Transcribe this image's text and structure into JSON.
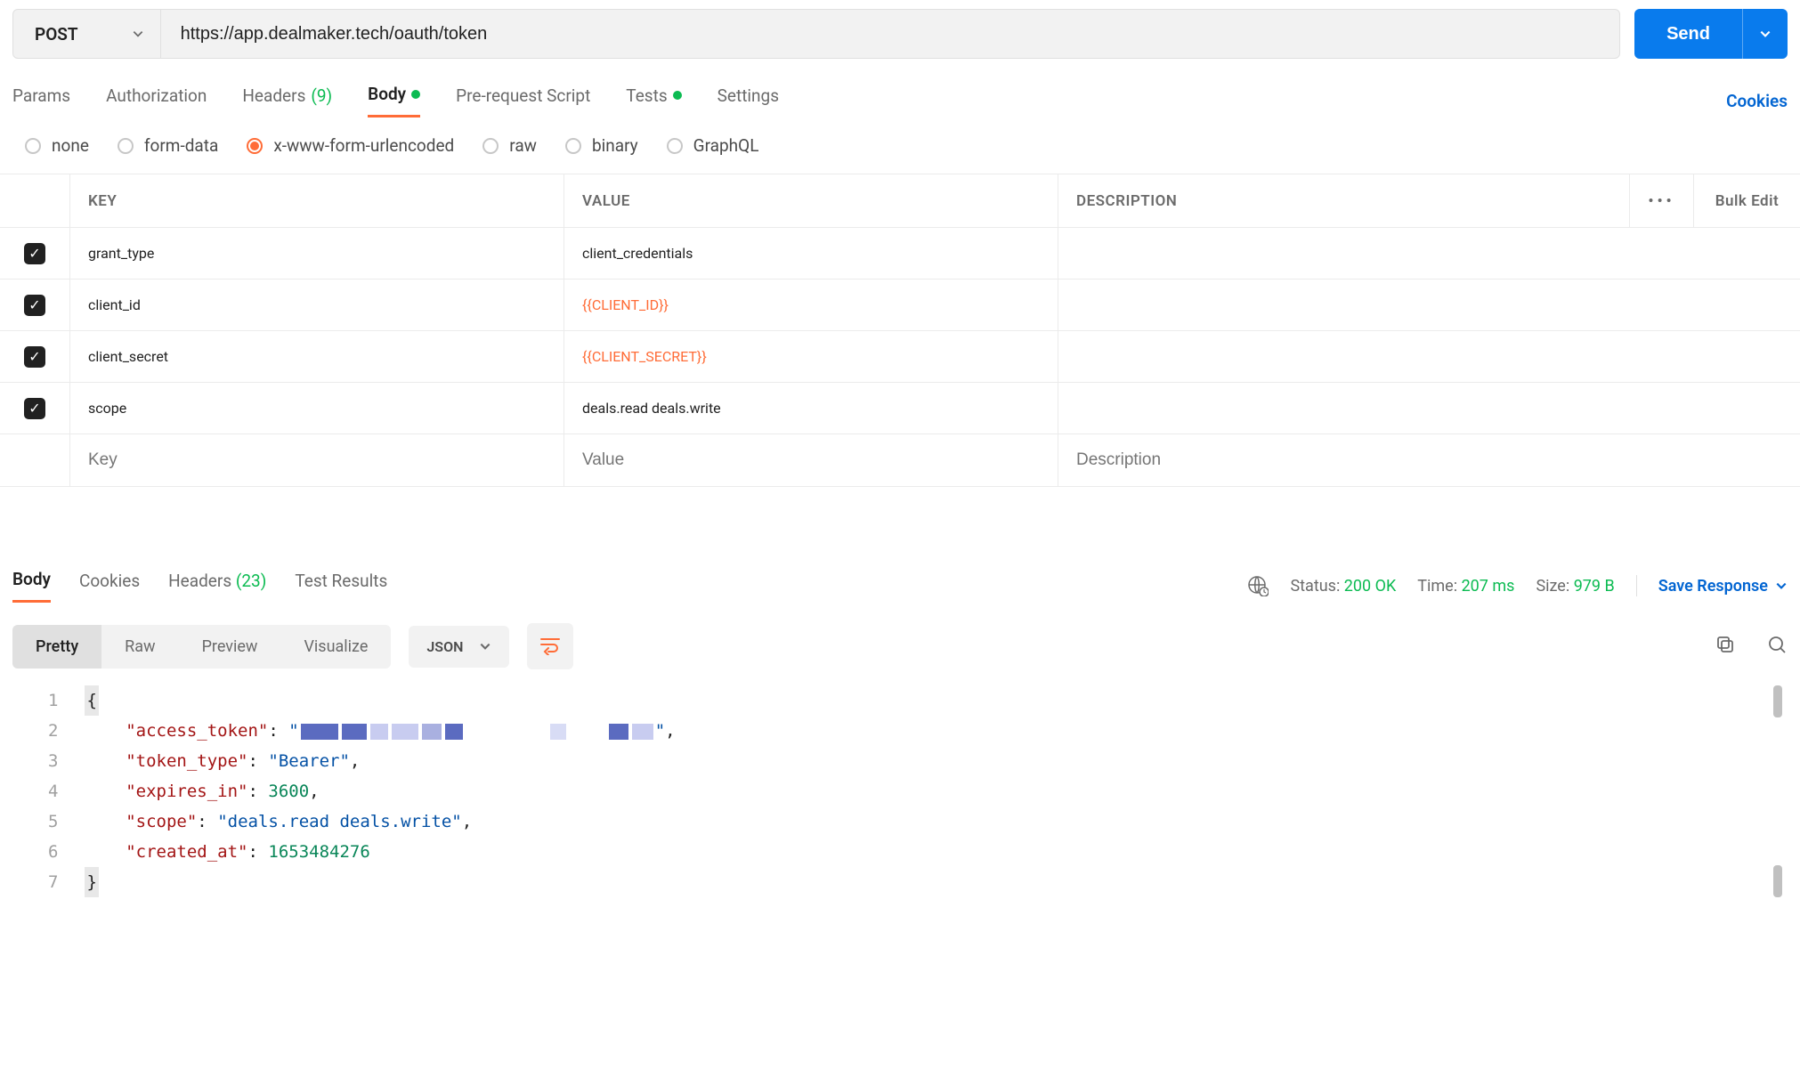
{
  "request": {
    "method": "POST",
    "url": "https://app.dealmaker.tech/oauth/token",
    "send_label": "Send"
  },
  "req_tabs": {
    "params": "Params",
    "authorization": "Authorization",
    "headers": "Headers",
    "headers_count": "(9)",
    "body": "Body",
    "prerequest": "Pre-request Script",
    "tests": "Tests",
    "settings": "Settings",
    "cookies": "Cookies"
  },
  "body_types": {
    "none": "none",
    "formdata": "form-data",
    "urlencoded": "x-www-form-urlencoded",
    "raw": "raw",
    "binary": "binary",
    "graphql": "GraphQL"
  },
  "kv": {
    "headers": {
      "key": "KEY",
      "value": "VALUE",
      "desc": "DESCRIPTION",
      "bulk": "Bulk Edit"
    },
    "rows": [
      {
        "key": "grant_type",
        "value": "client_credentials",
        "is_var": false
      },
      {
        "key": "client_id",
        "value": "{{CLIENT_ID}}",
        "is_var": true
      },
      {
        "key": "client_secret",
        "value": "{{CLIENT_SECRET}}",
        "is_var": true
      },
      {
        "key": "scope",
        "value": "deals.read deals.write",
        "is_var": false
      }
    ],
    "placeholders": {
      "key": "Key",
      "value": "Value",
      "desc": "Description"
    }
  },
  "response": {
    "tabs": {
      "body": "Body",
      "cookies": "Cookies",
      "headers": "Headers",
      "headers_count": "(23)",
      "testresults": "Test Results"
    },
    "status_label": "Status:",
    "status_value": "200 OK",
    "time_label": "Time:",
    "time_value": "207 ms",
    "size_label": "Size:",
    "size_value": "979 B",
    "save": "Save Response",
    "views": {
      "pretty": "Pretty",
      "raw": "Raw",
      "preview": "Preview",
      "visualize": "Visualize"
    },
    "lang": "JSON"
  },
  "json_body": {
    "access_token_key": "\"access_token\"",
    "access_token_val_prefix": "\"",
    "access_token_val_suffix": "\"",
    "token_type_key": "\"token_type\"",
    "token_type_val": "\"Bearer\"",
    "expires_in_key": "\"expires_in\"",
    "expires_in_val": "3600",
    "scope_key": "\"scope\"",
    "scope_val": "\"deals.read deals.write\"",
    "created_at_key": "\"created_at\"",
    "created_at_val": "1653484276"
  }
}
